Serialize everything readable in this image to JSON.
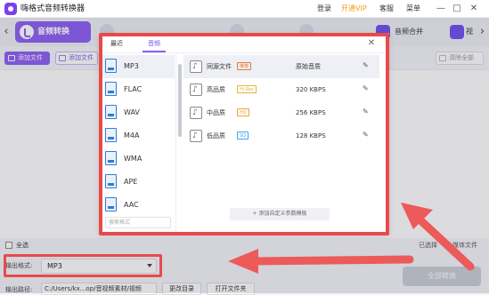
{
  "app": {
    "title": "嗨格式音频转换器",
    "links": {
      "login": "登录",
      "vip": "开通VIP",
      "service": "客服",
      "menu": "菜单"
    },
    "win_controls": {
      "minimize": "—",
      "maximize": "□",
      "close": "✕"
    }
  },
  "tabs": {
    "prev": "‹",
    "active_label": "音频转换",
    "merge_label": "音频合并",
    "video_label": "视",
    "next": "›"
  },
  "toolbar": {
    "add_file": "添加文件",
    "add_folder": "添加文件",
    "clear_list": "清除全部"
  },
  "list_footer": {
    "select_all": "全选",
    "selected_count": "已选择",
    "media_file": "媒体文件"
  },
  "bottom": {
    "output_format_label": "输出格式:",
    "output_format_value": "MP3",
    "output_path_label": "输出路径:",
    "output_path_value": "C:/Users/kx...op/音视频素材/视频",
    "change_dir": "更改目录",
    "open_folder": "打开文件夹",
    "convert_all": "全部转换"
  },
  "format_dialog": {
    "tabs": {
      "recent": "最近",
      "audio": "音频"
    },
    "close": "✕",
    "formats": [
      "MP3",
      "FLAC",
      "WAV",
      "M4A",
      "WMA",
      "APE",
      "AAC"
    ],
    "selected_format": "MP3",
    "search_placeholder": "搜索格式",
    "qualities": [
      {
        "name": "同源文件",
        "tag": "推荐",
        "value": "原始音质",
        "tag_color": "#e87a3a"
      },
      {
        "name": "高品质",
        "tag": "Hi-Res",
        "value": "320 KBPS",
        "tag_color": "#e8b23a"
      },
      {
        "name": "中品质",
        "tag": "HQ",
        "value": "256 KBPS",
        "tag_color": "#e8a23a"
      },
      {
        "name": "低品质",
        "tag": "SQ",
        "value": "128 KBPS",
        "tag_color": "#3aa7e8"
      }
    ],
    "add_custom": "+ 添加自定义参数模板"
  },
  "colors": {
    "brand": "#8b5cf6",
    "annotation": "#e84a4a",
    "vip": "#f39c12"
  }
}
